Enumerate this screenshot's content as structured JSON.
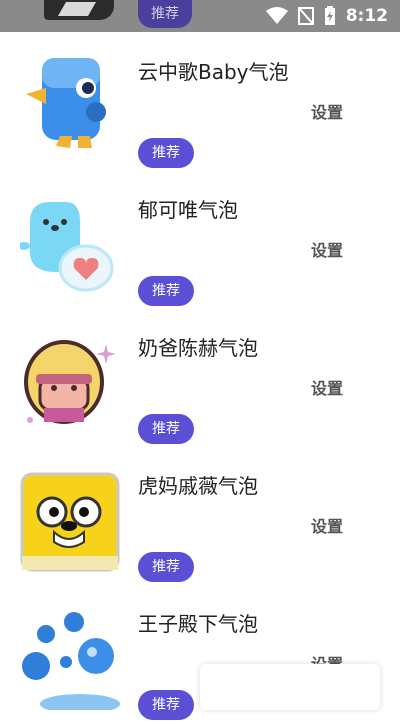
{
  "status_bar": {
    "tag_label": "推荐",
    "time": "8:12",
    "icons": [
      "wifi-icon",
      "no-signal-icon",
      "battery-charging-icon"
    ]
  },
  "items": [
    {
      "name": "云中歌Baby气泡",
      "setting_label": "设置",
      "tag_label": "推荐",
      "icon": "blue-bird-icon"
    },
    {
      "name": "郁可唯气泡",
      "setting_label": "设置",
      "tag_label": "推荐",
      "icon": "cyan-seal-heart-icon"
    },
    {
      "name": "奶爸陈赫气泡",
      "setting_label": "设置",
      "tag_label": "推荐",
      "icon": "blonde-girl-icon"
    },
    {
      "name": "虎妈戚薇气泡",
      "setting_label": "设置",
      "tag_label": "推荐",
      "icon": "yellow-dog-icon"
    },
    {
      "name": "王子殿下气泡",
      "setting_label": "设置",
      "tag_label": "推荐",
      "icon": "blue-bubbles-icon"
    }
  ]
}
